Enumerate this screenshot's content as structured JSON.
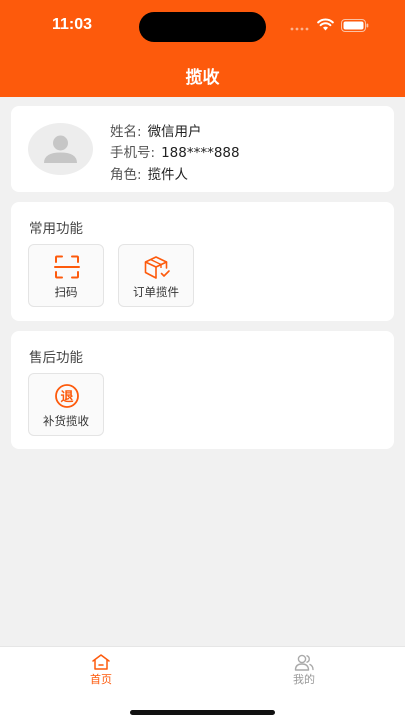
{
  "status_bar": {
    "time": "11:03"
  },
  "header": {
    "title": "揽收",
    "background_color": "#fd5a0c"
  },
  "user": {
    "avatar_icon": "user-avatar-icon",
    "name_label": "姓名:",
    "name_value": "微信用户",
    "phone_label": "手机号:",
    "phone_value": "188****888",
    "role_label": "角色:",
    "role_value": "揽件人"
  },
  "common_functions": {
    "title": "常用功能",
    "items": [
      {
        "label": "扫码",
        "icon": "scan-icon"
      },
      {
        "label": "订单揽件",
        "icon": "package-box-icon"
      }
    ]
  },
  "after_sale_functions": {
    "title": "售后功能",
    "items": [
      {
        "label": "补货揽收",
        "icon": "refund-circle-icon",
        "icon_glyph": "退"
      }
    ]
  },
  "tabbar": {
    "active_color": "#fd5a0c",
    "inactive_color": "#999999",
    "items": [
      {
        "label": "首页",
        "icon": "home-icon",
        "active": true
      },
      {
        "label": "我的",
        "icon": "profile-users-icon",
        "active": false
      }
    ]
  }
}
